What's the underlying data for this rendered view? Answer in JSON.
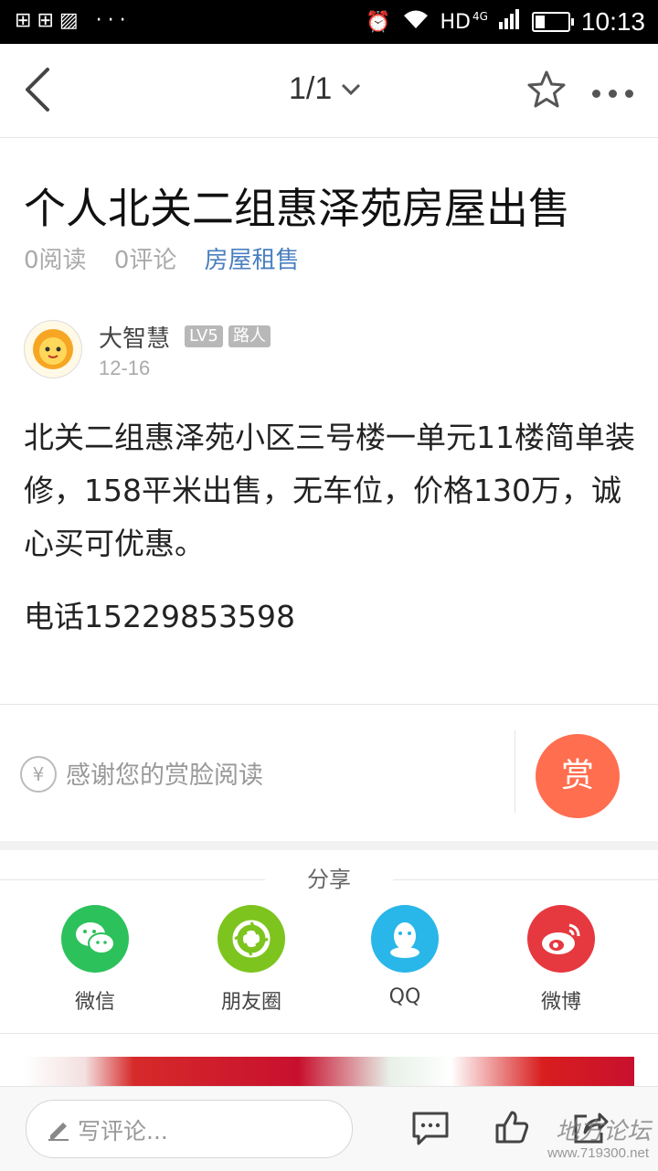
{
  "status_bar": {
    "left_icons": [
      "sim-icon",
      "sim-icon",
      "gallery-icon",
      "more-notifications-icon"
    ],
    "left_extra": "···",
    "network": "HD",
    "network_type": "4G",
    "time": "10:13",
    "battery_level": 0.3
  },
  "nav": {
    "page_indicator": "1/1"
  },
  "post": {
    "title": "个人北关二组惠泽苑房屋出售",
    "reads": "0阅读",
    "comments": "0评论",
    "category": "房屋租售",
    "author": {
      "name": "大智慧",
      "level_badge": "LV5",
      "role_badge": "路人",
      "date": "12-16"
    },
    "body": "北关二组惠泽苑小区三号楼一单元11楼简单装修，158平米出售，无车位，价格130万，诚心买可优惠。",
    "phone": "电话15229853598"
  },
  "reward": {
    "currency_symbol": "¥",
    "text": "感谢您的赏脸阅读",
    "button_label": "赏"
  },
  "share": {
    "title": "分享",
    "items": [
      {
        "label": "微信",
        "icon": "wechat-icon",
        "color": "#2dc15c"
      },
      {
        "label": "朋友圈",
        "icon": "moments-icon",
        "color": "#7dc41f"
      },
      {
        "label": "QQ",
        "icon": "qq-icon",
        "color": "#29b6e8"
      },
      {
        "label": "微博",
        "icon": "weibo-icon",
        "color": "#e6383f"
      }
    ]
  },
  "bottom_bar": {
    "comment_placeholder": "写评论...",
    "watermark": "地方论坛",
    "watermark_url": "www.719300.net"
  },
  "colors": {
    "accent_reward": "#ff6e4f",
    "category_link": "#4a7fbf"
  }
}
